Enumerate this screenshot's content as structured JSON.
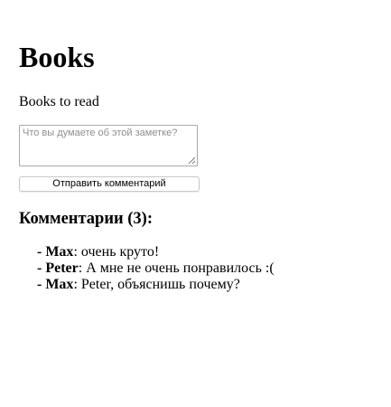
{
  "note": {
    "title": "Books",
    "text": "Books to read"
  },
  "comment_form": {
    "placeholder": "Что вы думаете об этой заметке?",
    "value": "",
    "submit_label": "Отправить комментарий"
  },
  "comments_section": {
    "heading": "Комментарии (3):",
    "items": [
      {
        "prefix": "- ",
        "author": "Max",
        "separator": ": ",
        "text": "очень круто!"
      },
      {
        "prefix": "- ",
        "author": "Peter",
        "separator": ": ",
        "text": "А мне не очень понравилось :("
      },
      {
        "prefix": "- ",
        "author": "Max",
        "separator": ": ",
        "text": "Peter, объяснишь почему?"
      }
    ]
  }
}
